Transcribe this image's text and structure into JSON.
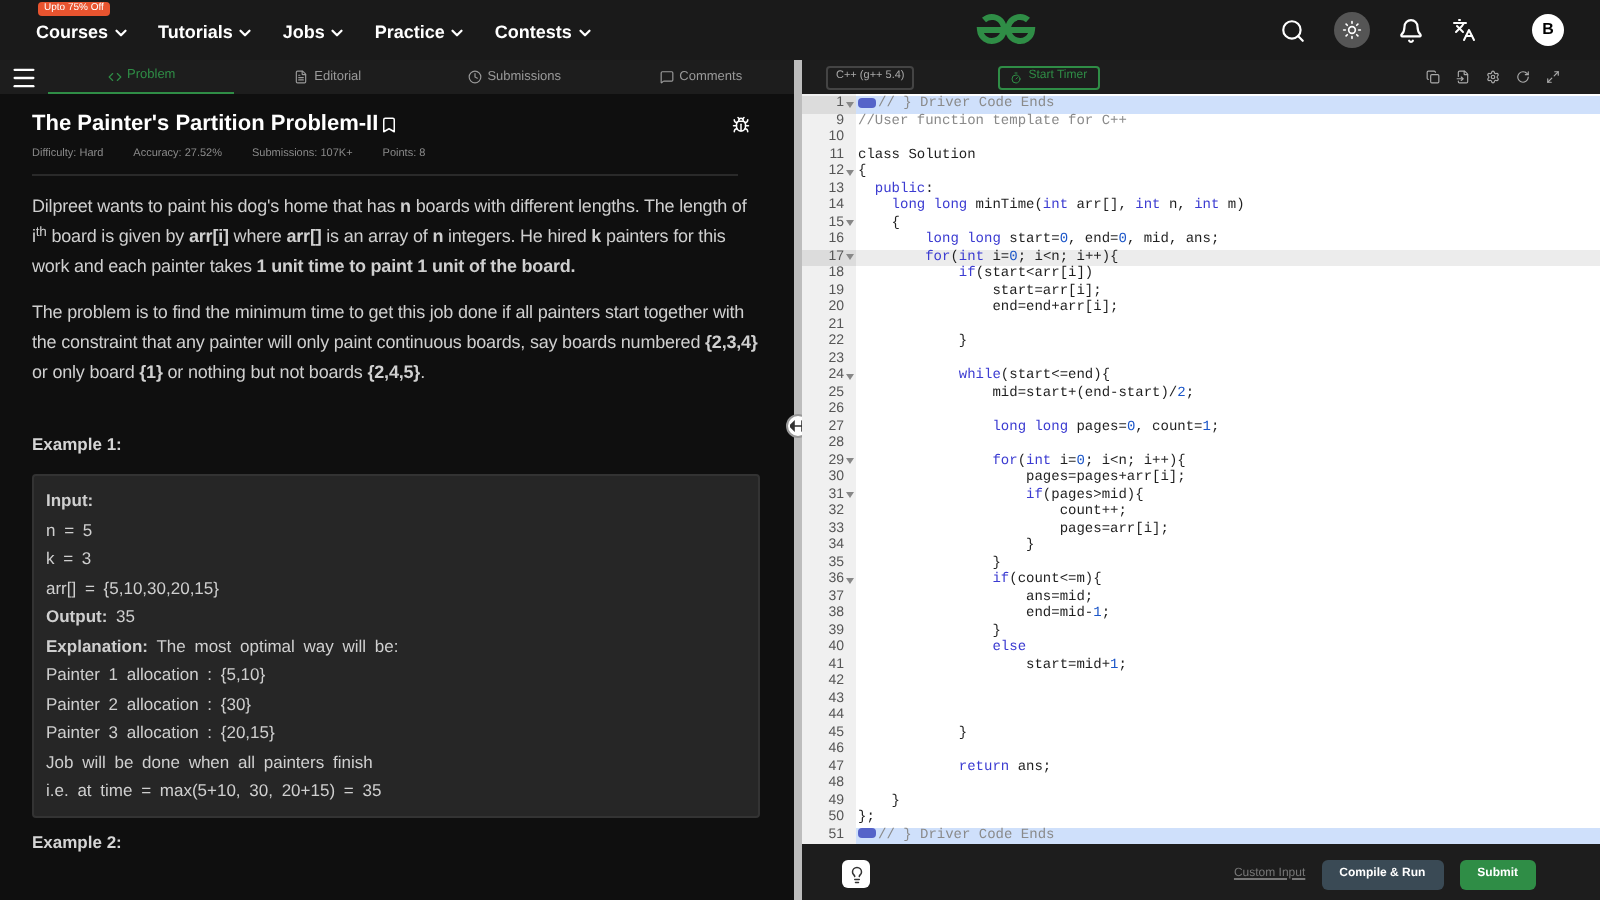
{
  "header": {
    "promo": "Upto 75% Off",
    "nav": [
      {
        "label": "Courses"
      },
      {
        "label": "Tutorials"
      },
      {
        "label": "Jobs"
      },
      {
        "label": "Practice"
      },
      {
        "label": "Contests"
      }
    ],
    "avatar": "B"
  },
  "tabs": [
    {
      "label": "Problem",
      "selected": true
    },
    {
      "label": "Editorial",
      "selected": false
    },
    {
      "label": "Submissions",
      "selected": false
    },
    {
      "label": "Comments",
      "selected": false
    }
  ],
  "problem": {
    "title": "The Painter's Partition Problem-II",
    "meta": [
      "Difficulty: Hard",
      "Accuracy: 27.52%",
      "Submissions: 107K+",
      "Points: 8"
    ],
    "paragraphs": [
      "Dilpreet wants to paint his dog's home that has **n** boards with different lengths. The length of i$^{th}$ board is given by **arr[i]** where **arr[]** is an array of **n** integers. He hired **k** painters for this work and each painter takes **1 unit time to paint 1 unit of the board.**",
      "The problem is to find the minimum time to get this job done if all painters start together with the constraint that any painter will only paint continuous boards, say boards numbered **{2,3,4}** or only board **{1}** or nothing but not boards **{2,4,5}**."
    ],
    "example_1": {
      "heading": "Example 1:",
      "lines": [
        "**Input:**",
        "n = 5",
        "k = 3",
        "arr[] = {5,10,30,20,15}",
        "**Output:** 35",
        "**Explanation:** The most optimal way will be:",
        "Painter 1 allocation : {5,10}",
        "Painter 2 allocation : {30}",
        "Painter 3 allocation : {20,15}",
        "Job will be done when all painters finish",
        "i.e. at time = max(5+10, 30, 20+15) = 35"
      ]
    },
    "example_2": {
      "heading": "Example 2:"
    }
  },
  "editor": {
    "language": "C++ (g++ 5.4)",
    "timer_button": "Start Timer",
    "lines": [
      {
        "number": "1",
        "foldable": true,
        "selected": true,
        "highlighted": true,
        "tokens": [
          {
            "kind": "fold"
          },
          {
            "kind": "comment",
            "text": "// } Driver Code Ends"
          }
        ]
      },
      {
        "number": "9",
        "foldable": false,
        "selected": false,
        "highlighted": false,
        "tokens": [
          {
            "kind": "comment",
            "text": "//User function template for C++"
          }
        ]
      },
      {
        "number": "10",
        "foldable": false,
        "selected": false,
        "highlighted": false
      },
      {
        "number": "11",
        "foldable": false,
        "selected": false,
        "highlighted": false,
        "tokens": [
          {
            "kind": "plain",
            "text": "class Solution"
          }
        ]
      },
      {
        "number": "12",
        "foldable": true,
        "selected": false,
        "highlighted": false,
        "tokens": [
          {
            "kind": "plain",
            "text": "{"
          }
        ]
      },
      {
        "number": "13",
        "foldable": false,
        "selected": false,
        "highlighted": false,
        "tokens": [
          {
            "kind": "kw",
            "text": "  public"
          },
          {
            "kind": "plain",
            "text": ":"
          }
        ]
      },
      {
        "number": "14",
        "foldable": false,
        "selected": false,
        "highlighted": false,
        "tokens": [
          {
            "kind": "kw",
            "text": "    long long"
          },
          {
            "kind": "plain",
            "text": " minTime("
          },
          {
            "kind": "kw",
            "text": "int"
          },
          {
            "kind": "plain",
            "text": " arr[], "
          },
          {
            "kind": "kw",
            "text": "int"
          },
          {
            "kind": "plain",
            "text": " n, "
          },
          {
            "kind": "kw",
            "text": "int"
          },
          {
            "kind": "plain",
            "text": " m)"
          }
        ]
      },
      {
        "number": "15",
        "foldable": true,
        "selected": false,
        "highlighted": false,
        "tokens": [
          {
            "kind": "plain",
            "text": "    {"
          }
        ]
      },
      {
        "number": "16",
        "foldable": false,
        "selected": false,
        "highlighted": false,
        "tokens": [
          {
            "kind": "kw",
            "text": "        long long"
          },
          {
            "kind": "plain",
            "text": " start="
          },
          {
            "kind": "num",
            "text": "0"
          },
          {
            "kind": "plain",
            "text": ", end="
          },
          {
            "kind": "num",
            "text": "0"
          },
          {
            "kind": "plain",
            "text": ", mid, ans;"
          }
        ]
      },
      {
        "number": "17",
        "foldable": true,
        "selected": false,
        "highlighted": true,
        "tokens": [
          {
            "kind": "kw",
            "text": "        for"
          },
          {
            "kind": "plain",
            "text": "("
          },
          {
            "kind": "kw",
            "text": "int"
          },
          {
            "kind": "plain",
            "text": " i="
          },
          {
            "kind": "num",
            "text": "0"
          },
          {
            "kind": "plain",
            "text": "; i<n; i++){"
          }
        ]
      },
      {
        "number": "18",
        "foldable": false,
        "selected": false,
        "highlighted": false,
        "tokens": [
          {
            "kind": "kw",
            "text": "            if"
          },
          {
            "kind": "plain",
            "text": "(start<arr[i])"
          }
        ]
      },
      {
        "number": "19",
        "foldable": false,
        "selected": false,
        "highlighted": false,
        "tokens": [
          {
            "kind": "plain",
            "text": "                start=arr[i];"
          }
        ]
      },
      {
        "number": "20",
        "foldable": false,
        "selected": false,
        "highlighted": false,
        "tokens": [
          {
            "kind": "plain",
            "text": "                end=end+arr[i];"
          }
        ]
      },
      {
        "number": "21",
        "foldable": false,
        "selected": false,
        "highlighted": false
      },
      {
        "number": "22",
        "foldable": false,
        "selected": false,
        "highlighted": false,
        "tokens": [
          {
            "kind": "plain",
            "text": "            }"
          }
        ]
      },
      {
        "number": "23",
        "foldable": false,
        "selected": false,
        "highlighted": false
      },
      {
        "number": "24",
        "foldable": true,
        "selected": false,
        "highlighted": false,
        "tokens": [
          {
            "kind": "kw",
            "text": "            while"
          },
          {
            "kind": "plain",
            "text": "(start<=end){"
          }
        ]
      },
      {
        "number": "25",
        "foldable": false,
        "selected": false,
        "highlighted": false,
        "tokens": [
          {
            "kind": "plain",
            "text": "                mid=start+(end-start)/"
          },
          {
            "kind": "num",
            "text": "2"
          },
          {
            "kind": "plain",
            "text": ";"
          }
        ]
      },
      {
        "number": "26",
        "foldable": false,
        "selected": false,
        "highlighted": false
      },
      {
        "number": "27",
        "foldable": false,
        "selected": false,
        "highlighted": false,
        "tokens": [
          {
            "kind": "kw",
            "text": "                long long"
          },
          {
            "kind": "plain",
            "text": " pages="
          },
          {
            "kind": "num",
            "text": "0"
          },
          {
            "kind": "plain",
            "text": ", count="
          },
          {
            "kind": "num",
            "text": "1"
          },
          {
            "kind": "plain",
            "text": ";"
          }
        ]
      },
      {
        "number": "28",
        "foldable": false,
        "selected": false,
        "highlighted": false
      },
      {
        "number": "29",
        "foldable": true,
        "selected": false,
        "highlighted": false,
        "tokens": [
          {
            "kind": "kw",
            "text": "                for"
          },
          {
            "kind": "plain",
            "text": "("
          },
          {
            "kind": "kw",
            "text": "int"
          },
          {
            "kind": "plain",
            "text": " i="
          },
          {
            "kind": "num",
            "text": "0"
          },
          {
            "kind": "plain",
            "text": "; i<n; i++){"
          }
        ]
      },
      {
        "number": "30",
        "foldable": false,
        "selected": false,
        "highlighted": false,
        "tokens": [
          {
            "kind": "plain",
            "text": "                    pages=pages+arr[i];"
          }
        ]
      },
      {
        "number": "31",
        "foldable": true,
        "selected": false,
        "highlighted": false,
        "tokens": [
          {
            "kind": "kw",
            "text": "                    if"
          },
          {
            "kind": "plain",
            "text": "(pages>mid){"
          }
        ]
      },
      {
        "number": "32",
        "foldable": false,
        "selected": false,
        "highlighted": false,
        "tokens": [
          {
            "kind": "plain",
            "text": "                        count++;"
          }
        ]
      },
      {
        "number": "33",
        "foldable": false,
        "selected": false,
        "highlighted": false,
        "tokens": [
          {
            "kind": "plain",
            "text": "                        pages=arr[i];"
          }
        ]
      },
      {
        "number": "34",
        "foldable": false,
        "selected": false,
        "highlighted": false,
        "tokens": [
          {
            "kind": "plain",
            "text": "                    }"
          }
        ]
      },
      {
        "number": "35",
        "foldable": false,
        "selected": false,
        "highlighted": false,
        "tokens": [
          {
            "kind": "plain",
            "text": "                }"
          }
        ]
      },
      {
        "number": "36",
        "foldable": true,
        "selected": false,
        "highlighted": false,
        "tokens": [
          {
            "kind": "kw",
            "text": "                if"
          },
          {
            "kind": "plain",
            "text": "(count<=m){"
          }
        ]
      },
      {
        "number": "37",
        "foldable": false,
        "selected": false,
        "highlighted": false,
        "tokens": [
          {
            "kind": "plain",
            "text": "                    ans=mid;"
          }
        ]
      },
      {
        "number": "38",
        "foldable": false,
        "selected": false,
        "highlighted": false,
        "tokens": [
          {
            "kind": "plain",
            "text": "                    end=mid-"
          },
          {
            "kind": "num",
            "text": "1"
          },
          {
            "kind": "plain",
            "text": ";"
          }
        ]
      },
      {
        "number": "39",
        "foldable": false,
        "selected": false,
        "highlighted": false,
        "tokens": [
          {
            "kind": "plain",
            "text": "                }"
          }
        ]
      },
      {
        "number": "40",
        "foldable": false,
        "selected": false,
        "highlighted": false,
        "tokens": [
          {
            "kind": "kw",
            "text": "                else"
          }
        ]
      },
      {
        "number": "41",
        "foldable": false,
        "selected": false,
        "highlighted": false,
        "tokens": [
          {
            "kind": "plain",
            "text": "                    start=mid+"
          },
          {
            "kind": "num",
            "text": "1"
          },
          {
            "kind": "plain",
            "text": ";"
          }
        ]
      },
      {
        "number": "42",
        "foldable": false,
        "selected": false,
        "highlighted": false
      },
      {
        "number": "43",
        "foldable": false,
        "selected": false,
        "highlighted": false
      },
      {
        "number": "44",
        "foldable": false,
        "selected": false,
        "highlighted": false
      },
      {
        "number": "45",
        "foldable": false,
        "selected": false,
        "highlighted": false,
        "tokens": [
          {
            "kind": "plain",
            "text": "            }"
          }
        ]
      },
      {
        "number": "46",
        "foldable": false,
        "selected": false,
        "highlighted": false
      },
      {
        "number": "47",
        "foldable": false,
        "selected": false,
        "highlighted": false,
        "tokens": [
          {
            "kind": "kw",
            "text": "            return"
          },
          {
            "kind": "plain",
            "text": " ans;"
          }
        ]
      },
      {
        "number": "48",
        "foldable": false,
        "selected": false,
        "highlighted": false
      },
      {
        "number": "49",
        "foldable": false,
        "selected": false,
        "highlighted": false,
        "tokens": [
          {
            "kind": "plain",
            "text": "    }"
          }
        ]
      },
      {
        "number": "50",
        "foldable": false,
        "selected": false,
        "highlighted": false,
        "tokens": [
          {
            "kind": "plain",
            "text": "};"
          }
        ]
      },
      {
        "number": "51",
        "foldable": false,
        "selected": true,
        "highlighted": false,
        "tokens": [
          {
            "kind": "fold"
          },
          {
            "kind": "comment",
            "text": "// } Driver Code Ends"
          }
        ]
      }
    ],
    "footer": {
      "custom_input": "Custom Input",
      "compile_button": "Compile & Run",
      "submit_button": "Submit"
    }
  }
}
